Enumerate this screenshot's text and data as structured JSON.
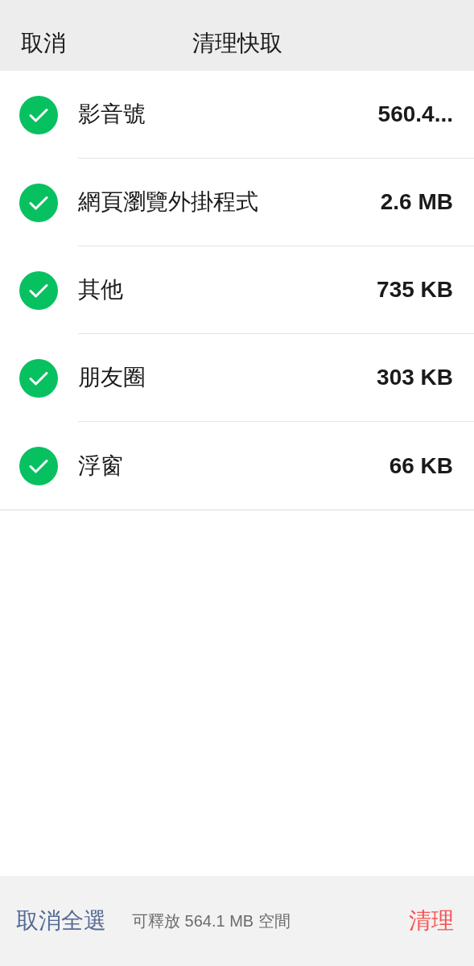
{
  "header": {
    "cancel": "取消",
    "title": "清理快取"
  },
  "items": [
    {
      "label": "影音號",
      "size": "560.4...",
      "checked": true
    },
    {
      "label": "網頁瀏覽外掛程式",
      "size": "2.6 MB",
      "checked": true
    },
    {
      "label": "其他",
      "size": "735 KB",
      "checked": true
    },
    {
      "label": "朋友圈",
      "size": "303 KB",
      "checked": true
    },
    {
      "label": "浮窗",
      "size": "66 KB",
      "checked": true
    }
  ],
  "footer": {
    "deselect_all": "取消全選",
    "summary": "可釋放 564.1 MB 空間",
    "clean": "清理"
  }
}
